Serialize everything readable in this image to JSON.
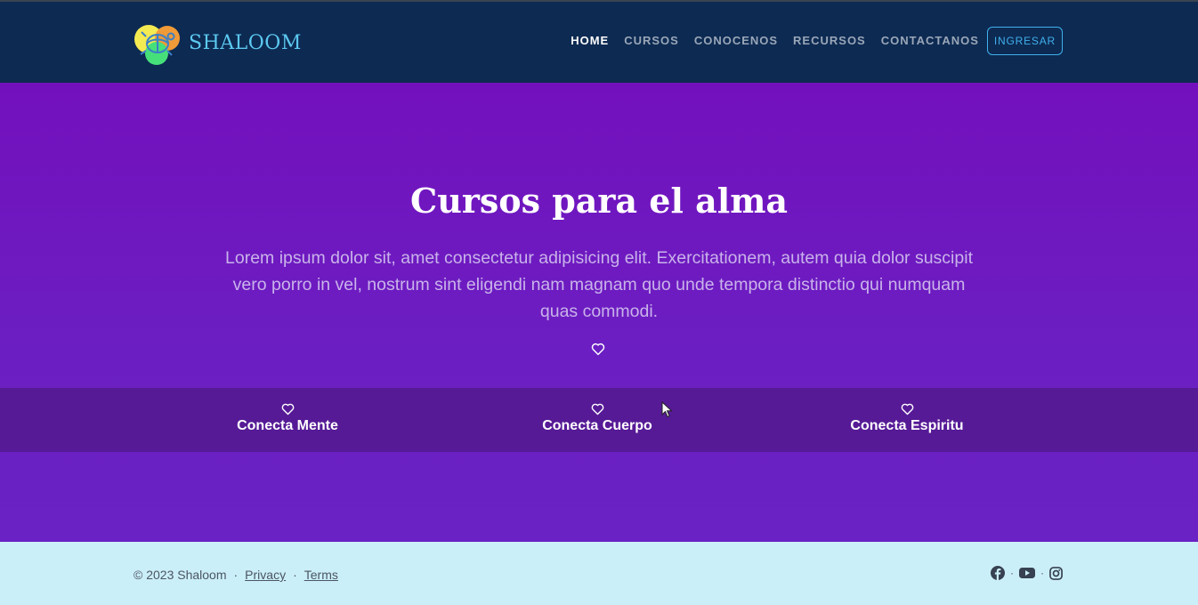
{
  "brand": {
    "name": "SHALOOM"
  },
  "nav": {
    "items": [
      "HOME",
      "CURSOS",
      "CONOCENOS",
      "RECURSOS",
      "CONTACTANOS"
    ],
    "login": "INGRESAR"
  },
  "hero": {
    "title": "Cursos para el alma",
    "text": "Lorem ipsum dolor sit, amet consectetur adipisicing elit. Exercitationem, autem quia dolor suscipit vero porro in vel, nostrum sint eligendi nam magnam quo unde tempora distinctio qui numquam quas commodi."
  },
  "features": [
    "Conecta Mente",
    "Conecta Cuerpo",
    "Conecta Espiritu"
  ],
  "footer": {
    "copyright": "© 2023 Shaloom",
    "separator": "·",
    "privacy": "Privacy",
    "terms": "Terms"
  },
  "socials": [
    "facebook-icon",
    "youtube-icon",
    "instagram-icon"
  ],
  "colors": {
    "navbar": "#0d2a52",
    "hero": "#6a22c4",
    "features_band": "#561a96",
    "footer": "#cbeff8",
    "accent": "#3fb0ec"
  }
}
